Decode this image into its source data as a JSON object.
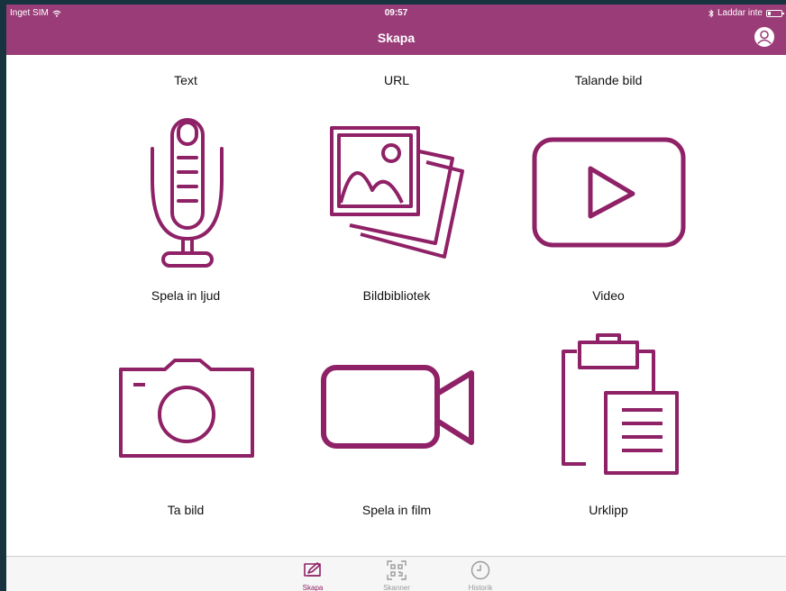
{
  "status_bar": {
    "carrier": "Inget SIM",
    "time": "09:57",
    "charging": "Laddar inte"
  },
  "header": {
    "title": "Skapa"
  },
  "options": {
    "text": "Text",
    "url": "URL",
    "talking_picture": "Talande bild",
    "record_audio": "Spela in ljud",
    "photo_library": "Bildbibliotek",
    "video": "Video",
    "take_photo": "Ta bild",
    "record_film": "Spela in film",
    "clipboard": "Urklipp"
  },
  "tabbar": {
    "create": "Skapa",
    "scanner": "Skanner",
    "history": "Historik"
  },
  "colors": {
    "accent": "#8f2166",
    "header": "#9a3c78"
  }
}
